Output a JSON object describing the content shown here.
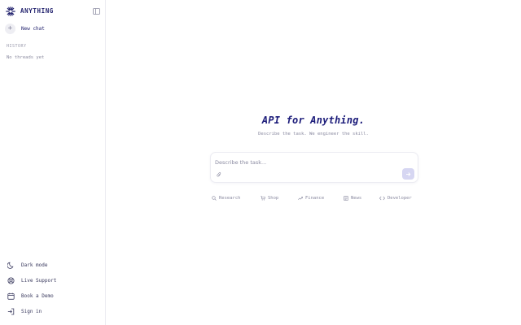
{
  "sidebar": {
    "brand_name": "ANYTHING",
    "new_chat_label": "New chat",
    "history_title": "HISTORY",
    "no_threads": "No threads yet",
    "footer": {
      "dark_mode": "Dark mode",
      "live_support": "Live Support",
      "book_demo": "Book a Demo",
      "sign_in": "Sign in"
    }
  },
  "main": {
    "title": "API for Anything.",
    "subtitle": "Describe the task. We engineer the skill.",
    "input_placeholder": "Describe the task...",
    "chips": {
      "research": "Research",
      "shop": "Shop",
      "finance": "Finance",
      "news": "News",
      "developer": "Developer"
    }
  },
  "colors": {
    "brand": "#23236e",
    "title": "#1c1c7a",
    "muted": "#8a8aa0",
    "send_button": "#d6d6f2",
    "border": "#ececf2"
  }
}
